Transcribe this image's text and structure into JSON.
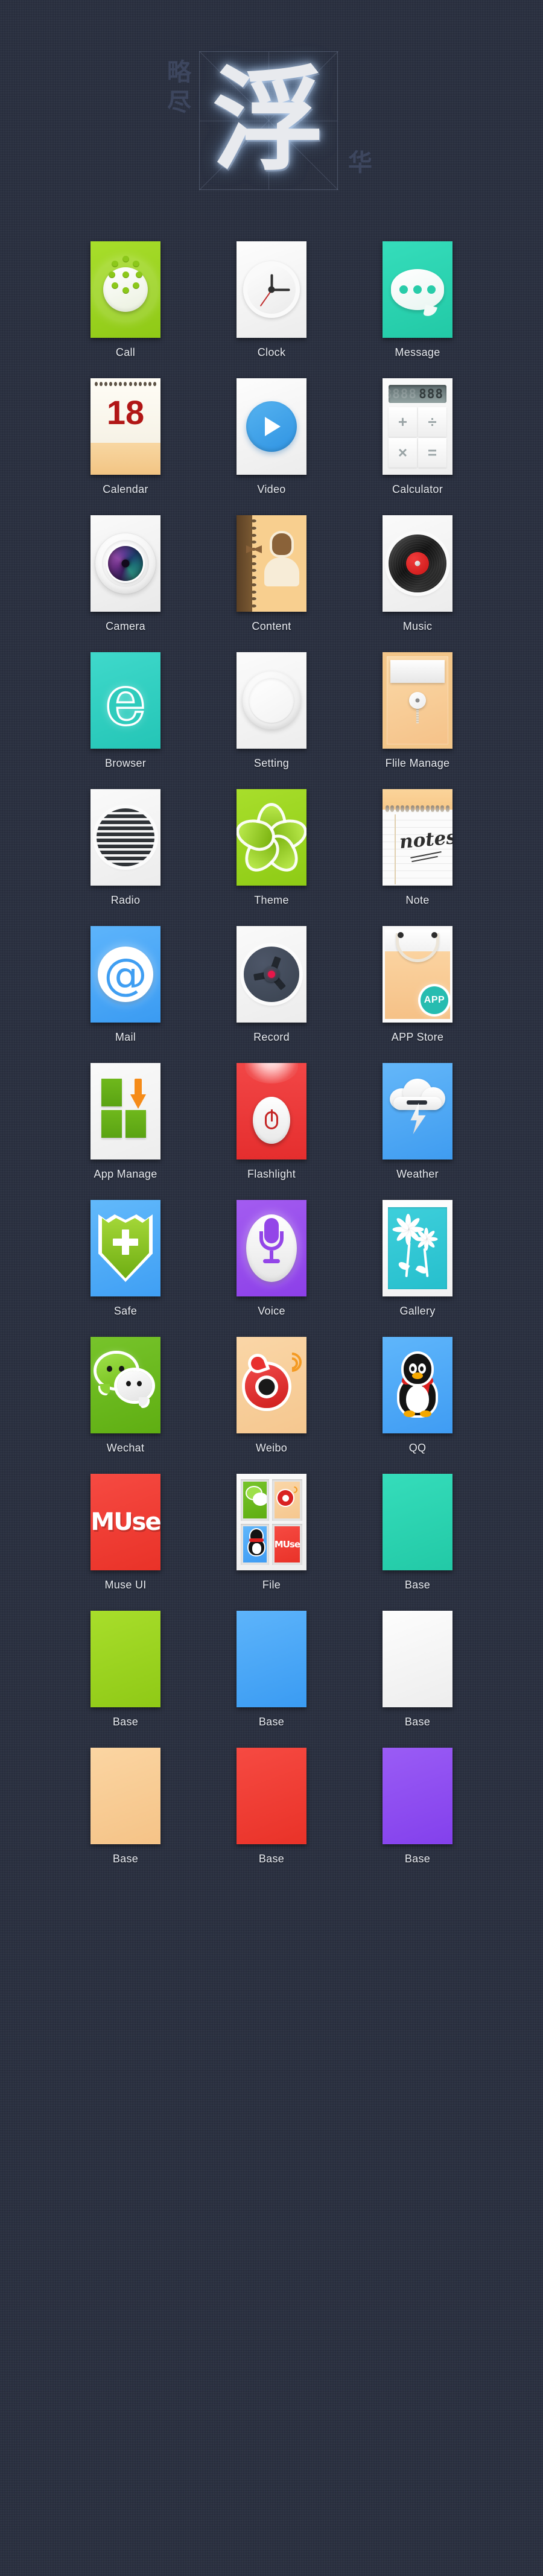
{
  "header": {
    "left_chars": "略\n尽",
    "main_char": "浮",
    "right_char": "华"
  },
  "grid": {
    "rows": [
      [
        {
          "label": "Call",
          "icon": "phone-dialpad-icon",
          "bg": "#9bd41f"
        },
        {
          "label": "Clock",
          "icon": "analog-clock-icon",
          "bg": "#f7f7f7"
        },
        {
          "label": "Message",
          "icon": "speech-bubble-icon",
          "bg": "#2ad0af"
        }
      ],
      [
        {
          "label": "Calendar",
          "icon": "calendar-icon",
          "bg": "#f6cf92",
          "day": "18"
        },
        {
          "label": "Video",
          "icon": "play-button-icon",
          "bg": "#f7f7f7"
        },
        {
          "label": "Calculator",
          "icon": "calculator-icon",
          "bg": "#f4f4f4",
          "display_dim": "8888",
          "display_on": "888",
          "keys": [
            "+",
            "÷",
            "×",
            "="
          ]
        }
      ],
      [
        {
          "label": "Camera",
          "icon": "camera-lens-icon",
          "bg": "#f3f3f3"
        },
        {
          "label": "Content",
          "icon": "contacts-notebook-icon",
          "bg": "#f8cf8f"
        },
        {
          "label": "Music",
          "icon": "vinyl-record-icon",
          "bg": "#f3f3f3"
        }
      ],
      [
        {
          "label": "Browser",
          "icon": "letter-e-icon",
          "bg": "#2ecbbc",
          "glyph": "e"
        },
        {
          "label": "Setting",
          "icon": "dial-knob-icon",
          "bg": "#f6f6f6"
        },
        {
          "label": "Flile Manage",
          "icon": "envelope-folder-icon",
          "bg": "#f3c689"
        }
      ],
      [
        {
          "label": "Radio",
          "icon": "speaker-grille-icon",
          "bg": "#f3f3f3"
        },
        {
          "label": "Theme",
          "icon": "clover-flower-icon",
          "bg": "#9bd41f"
        },
        {
          "label": "Note",
          "icon": "notepad-icon",
          "bg": "#fafafa",
          "word": "notes"
        }
      ],
      [
        {
          "label": "Mail",
          "icon": "at-sign-icon",
          "bg": "#4ba6f6",
          "glyph": "@"
        },
        {
          "label": "Record",
          "icon": "tape-reel-icon",
          "bg": "#f3f3f3"
        },
        {
          "label": "APP Store",
          "icon": "shopping-bag-icon",
          "bg": "#f7c68b",
          "badge": "APP"
        }
      ],
      [
        {
          "label": "App Manage",
          "icon": "app-grid-download-icon",
          "bg": "#f5f5f5"
        },
        {
          "label": "Flashlight",
          "icon": "flashlight-power-icon",
          "bg": "#ea3a38"
        },
        {
          "label": "Weather",
          "icon": "cloud-lightning-icon",
          "bg": "#51a8f4"
        }
      ],
      [
        {
          "label": "Safe",
          "icon": "shield-cross-icon",
          "bg": "#4fa9f7"
        },
        {
          "label": "Voice",
          "icon": "microphone-icon",
          "bg": "#954ded"
        },
        {
          "label": "Gallery",
          "icon": "flower-photo-icon",
          "bg": "#ffffff"
        }
      ],
      [
        {
          "label": "Wechat",
          "icon": "wechat-bubbles-icon",
          "bg": "#6bbb20"
        },
        {
          "label": "Weibo",
          "icon": "weibo-eye-icon",
          "bg": "#f7cd99"
        },
        {
          "label": "QQ",
          "icon": "qq-penguin-icon",
          "bg": "#4ea9f7"
        }
      ],
      [
        {
          "label": "Muse UI",
          "icon": "muse-cube-logo-icon",
          "bg": "#ee3b31",
          "glyph": "MUse"
        },
        {
          "label": "File",
          "icon": "folder-grid-icon",
          "bg": "#f4f4f4"
        },
        {
          "label": "Base",
          "icon": "solid-color-tile",
          "bg": "#2ad0af"
        }
      ],
      [
        {
          "label": "Base",
          "icon": "solid-color-tile",
          "bg": "#9bd41f"
        },
        {
          "label": "Base",
          "icon": "solid-color-tile",
          "bg": "#4ba6f6"
        },
        {
          "label": "Base",
          "icon": "solid-color-tile",
          "bg": "#f4f4f4"
        }
      ],
      [
        {
          "label": "Base",
          "icon": "solid-color-tile",
          "bg": "#f8ca8f"
        },
        {
          "label": "Base",
          "icon": "solid-color-tile",
          "bg": "#ee3b31"
        },
        {
          "label": "Base",
          "icon": "solid-color-tile",
          "bg": "#8a4df0"
        }
      ]
    ]
  },
  "colors": {
    "background": "#2b3141",
    "label_text": "#e9ecf2",
    "header_glow": "#e8eaee",
    "header_side": "#3d465e"
  }
}
